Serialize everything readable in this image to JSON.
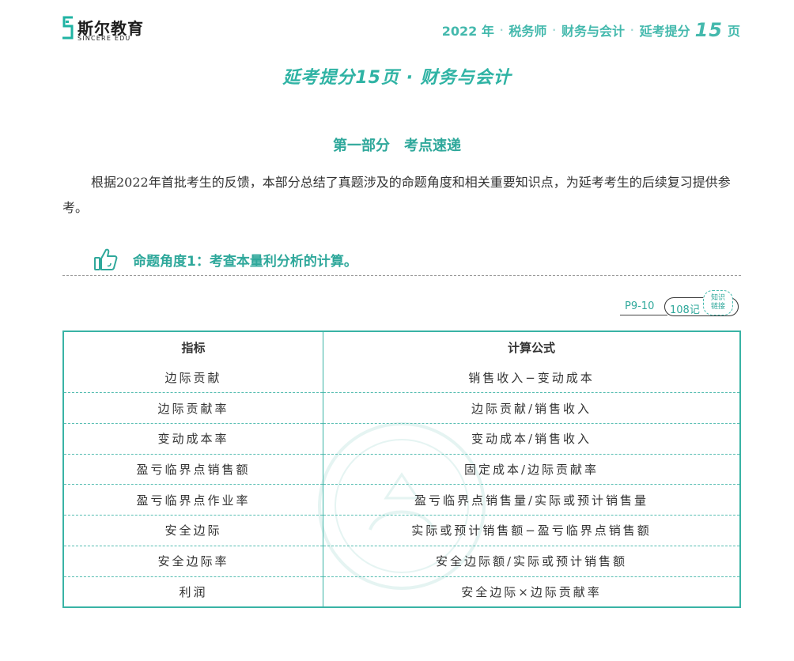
{
  "logo": {
    "cn": "斯尔教育",
    "en": "SINCERE EDU",
    "mark": "S-logo"
  },
  "header": {
    "year": "2022 年",
    "exam": "税务师",
    "subject": "财务与会计",
    "series_prefix": "延考提分",
    "series_num": "15",
    "series_suffix": "页"
  },
  "title": "延考提分15页 · 财务与会计",
  "section": {
    "part": "第一部分",
    "name": "考点速递"
  },
  "intro": "根据2022年首批考生的反馈，本部分总结了真题涉及的命题角度和相关重要知识点，为延考考生的后续复习提供参考。",
  "topic": {
    "icon": "thumbs-up-icon",
    "text": "命题角度1：考查本量利分析的计算。"
  },
  "ref": {
    "pages": "P9-10",
    "note": "108记",
    "badge_line1": "知识",
    "badge_line2": "链接"
  },
  "table": {
    "headers": [
      "指标",
      "计算公式"
    ],
    "rows": [
      [
        "边际贡献",
        "销售收入−变动成本"
      ],
      [
        "边际贡献率",
        "边际贡献/销售收入"
      ],
      [
        "变动成本率",
        "变动成本/销售收入"
      ],
      [
        "盈亏临界点销售额",
        "固定成本/边际贡献率"
      ],
      [
        "盈亏临界点作业率",
        "盈亏临界点销售量/实际或预计销售量"
      ],
      [
        "安全边际",
        "实际或预计销售额−盈亏临界点销售额"
      ],
      [
        "安全边际率",
        "安全边际额/实际或预计销售额"
      ],
      [
        "利润",
        "安全边际×边际贡献率"
      ]
    ]
  },
  "colors": {
    "accent": "#2fa89b",
    "accent_light": "#44b9ad",
    "border": "#39b3a5"
  }
}
